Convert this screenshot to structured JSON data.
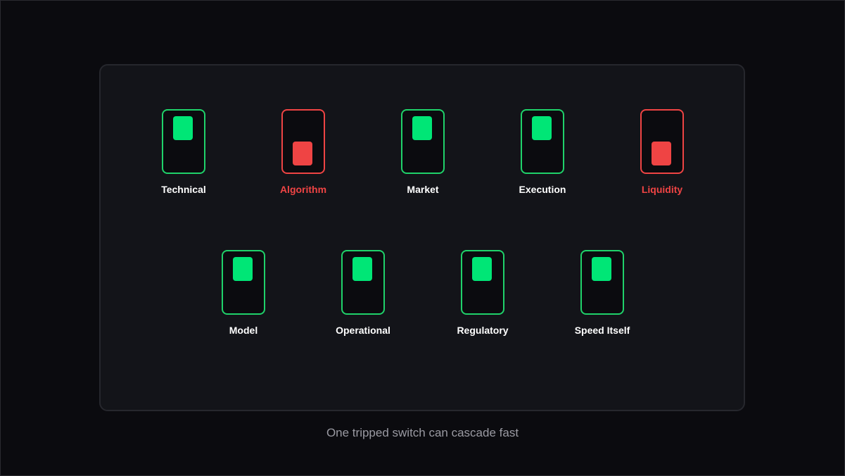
{
  "switches": [
    {
      "label": "Technical",
      "state": "on"
    },
    {
      "label": "Algorithm",
      "state": "off"
    },
    {
      "label": "Market",
      "state": "on"
    },
    {
      "label": "Execution",
      "state": "on"
    },
    {
      "label": "Liquidity",
      "state": "off"
    },
    {
      "label": "Model",
      "state": "on"
    },
    {
      "label": "Operational",
      "state": "on"
    },
    {
      "label": "Regulatory",
      "state": "on"
    },
    {
      "label": "Speed Itself",
      "state": "on"
    }
  ],
  "caption": "One tripped switch can cascade fast",
  "colors": {
    "on": "#00e676",
    "off": "#ef4444",
    "background": "#0b0b0f",
    "panel": "#131419"
  }
}
